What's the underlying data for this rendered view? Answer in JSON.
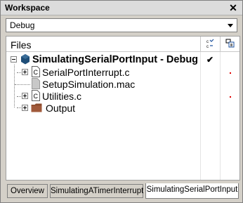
{
  "window": {
    "title": "Workspace",
    "close_glyph": "✕"
  },
  "config_select": {
    "value": "Debug"
  },
  "header": {
    "files_label": "Files",
    "col1_icon": "build-status-icon",
    "col2_icon": "code-info-icon"
  },
  "tree": {
    "root": {
      "label": "SimulatingSerialPortInput - Debug",
      "check": "✔",
      "icon": "project-cube-icon"
    },
    "items": [
      {
        "label": "SerialPortInterrupt.c",
        "icon": "c-file-icon",
        "expandable": true,
        "modified": true
      },
      {
        "label": "SetupSimulation.mac",
        "icon": "macro-file-icon",
        "expandable": false,
        "modified": false
      },
      {
        "label": "Utilities.c",
        "icon": "c-file-icon",
        "expandable": true,
        "modified": true
      },
      {
        "label": "Output",
        "icon": "folder-icon",
        "expandable": true,
        "modified": false
      }
    ]
  },
  "tabs": [
    {
      "label": "Overview",
      "active": false
    },
    {
      "label": "SimulatingATimerInterrupt",
      "active": false
    },
    {
      "label": "SimulatingSerialPortInput",
      "active": true
    }
  ],
  "colors": {
    "modified_dot": "#e00000",
    "project_icon": "#1f4e78",
    "folder": "#8b4a2b"
  }
}
